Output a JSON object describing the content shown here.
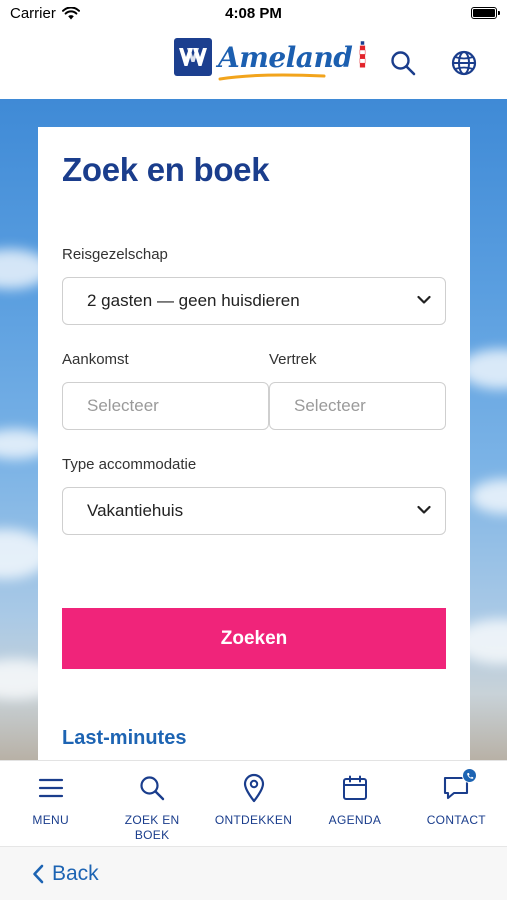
{
  "status_bar": {
    "carrier": "Carrier",
    "time": "4:08 PM"
  },
  "header": {
    "logo_text": "Ameland",
    "icons": [
      "search-icon",
      "globe-icon"
    ]
  },
  "card": {
    "title": "Zoek en boek",
    "party_label": "Reisgezelschap",
    "party_value": "2 gasten — geen huisdieren",
    "arrival_label": "Aankomst",
    "arrival_placeholder": "Selecteer",
    "departure_label": "Vertrek",
    "departure_placeholder": "Selecteer",
    "type_label": "Type accommodatie",
    "type_value": "Vakantiehuis",
    "search_button": "Zoeken",
    "last_minutes": "Last-minutes"
  },
  "tab_bar": {
    "items": [
      {
        "label": "MENU",
        "icon": "menu-icon"
      },
      {
        "label": "ZOEK EN BOEK",
        "icon": "search-icon"
      },
      {
        "label": "ONTDEKKEN",
        "icon": "location-pin-icon"
      },
      {
        "label": "AGENDA",
        "icon": "calendar-icon"
      },
      {
        "label": "CONTACT",
        "icon": "chat-icon"
      }
    ]
  },
  "footer": {
    "back_label": "Back"
  },
  "colors": {
    "brand_blue": "#1a3d8c",
    "link_blue": "#1d64b3",
    "accent_pink": "#f0247a"
  }
}
